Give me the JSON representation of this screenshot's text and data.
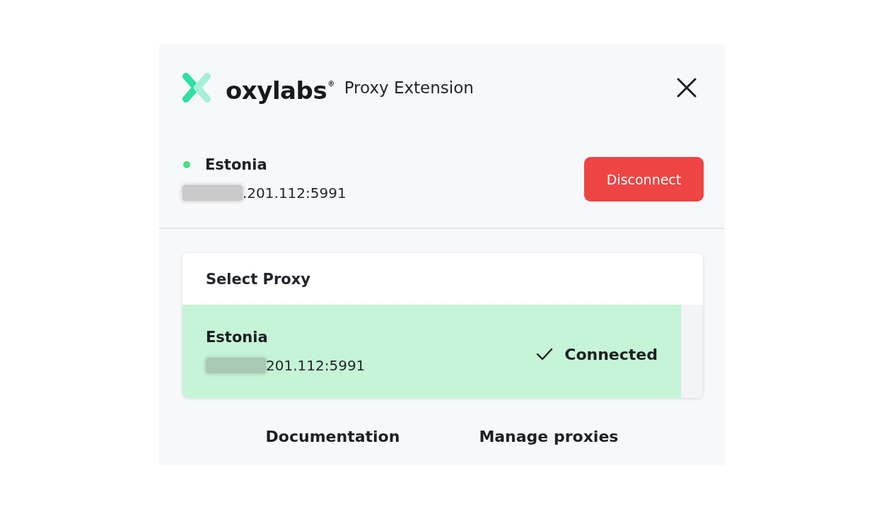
{
  "header": {
    "brand": "oxylabs$^{®}$",
    "subtitle": "Proxy Extension"
  },
  "connection": {
    "connected": true,
    "location": "Estonia",
    "address": ".201.112:5991",
    "address_masked": true,
    "disconnect_button": "Disconnect"
  },
  "proxy_list": {
    "title": "Select Proxy",
    "items": [
      {
        "name": "Estonia",
        "address": "201.112:5991",
        "address_masked": true,
        "selected": true,
        "status": "Connected"
      }
    ]
  },
  "footer_links": [
    "Documentation",
    "Manage proxies"
  ]
}
